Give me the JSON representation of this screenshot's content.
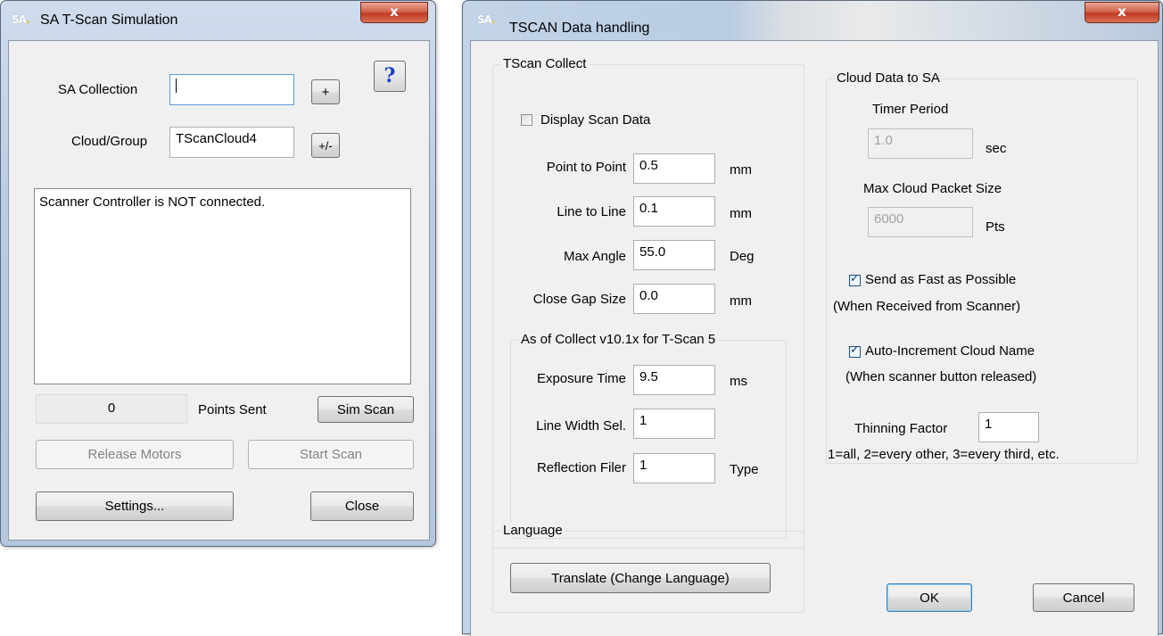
{
  "sim_window": {
    "logo": "SA",
    "title": "SA T-Scan Simulation",
    "close_glyph": "x",
    "help_label": "?",
    "sa_collection_label": "SA Collection",
    "sa_collection_value": "",
    "plus_label": "+",
    "cloud_group_label": "Cloud/Group",
    "cloud_group_value": "TScanCloud4",
    "plus_minus_label": "+/-",
    "status_message": "Scanner Controller is NOT connected.",
    "points_sent_value": "0",
    "points_sent_label": "Points Sent",
    "sim_scan_label": "Sim Scan",
    "release_motors_label": "Release Motors",
    "start_scan_label": "Start Scan",
    "settings_label": "Settings...",
    "close_label": "Close"
  },
  "data_window": {
    "logo": "SA",
    "title": "TSCAN Data handling",
    "close_glyph": "x",
    "collect_group": {
      "title": "TScan Collect",
      "display_scan_label": "Display Scan Data",
      "display_scan_checked": false,
      "point_to_point_label": "Point to Point",
      "point_to_point_value": "0.5",
      "point_to_point_unit": "mm",
      "line_to_line_label": "Line to Line",
      "line_to_line_value": "0.1",
      "line_to_line_unit": "mm",
      "max_angle_label": "Max Angle",
      "max_angle_value": "55.0",
      "max_angle_unit": "Deg",
      "close_gap_label": "Close Gap Size",
      "close_gap_value": "0.0",
      "close_gap_unit": "mm"
    },
    "version_group": {
      "title": "As of Collect v10.1x for T-Scan 5",
      "exposure_label": "Exposure Time",
      "exposure_value": "9.5",
      "exposure_unit": "ms",
      "line_width_label": "Line Width Sel.",
      "line_width_value": "1",
      "reflection_label": "Reflection Filer",
      "reflection_value": "1",
      "reflection_unit": "Type"
    },
    "language_group": {
      "title": "Language",
      "translate_label": "Translate (Change Language)"
    },
    "cloud_group": {
      "title": "Cloud Data to SA",
      "timer_label": "Timer Period",
      "timer_value": "1.0",
      "timer_unit": "sec",
      "packet_label": "Max Cloud Packet Size",
      "packet_value": "6000",
      "packet_unit": "Pts",
      "send_fast_label": "Send as Fast as Possible",
      "send_fast_checked": true,
      "send_fast_note": "(When Received from Scanner)",
      "auto_inc_label": "Auto-Increment Cloud Name",
      "auto_inc_checked": true,
      "auto_inc_note": "(When scanner button released)",
      "thinning_label": "Thinning Factor",
      "thinning_value": "1",
      "thinning_note": "1=all, 2=every other, 3=every third, etc."
    },
    "ok_label": "OK",
    "cancel_label": "Cancel"
  }
}
